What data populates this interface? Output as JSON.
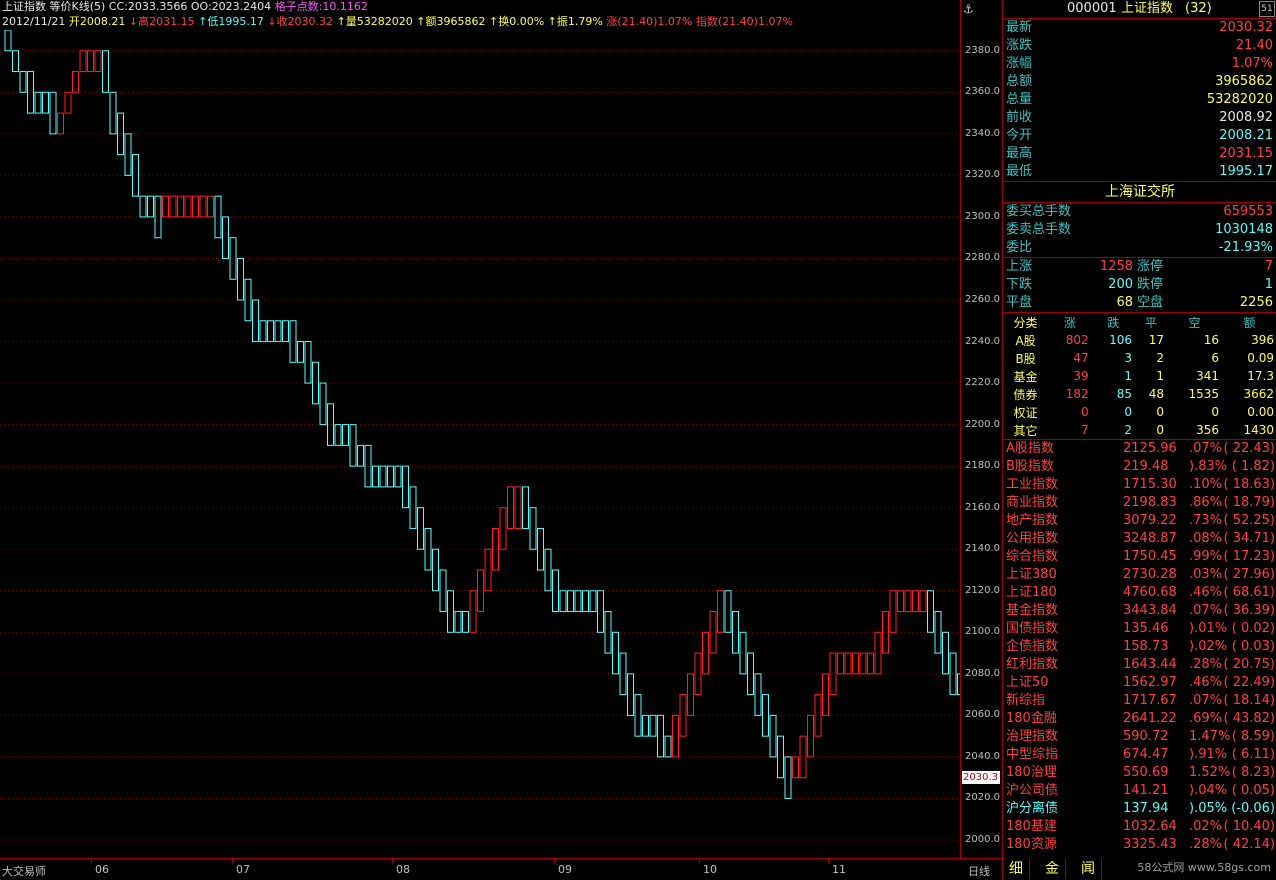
{
  "header": {
    "title": "上证指数",
    "chart_type": "等价K线(5)",
    "cc": "CC:2033.3566",
    "oo": "OO:2023.2404",
    "grid_points": "格子点数:10.1162",
    "date": "2012/11/21",
    "open": "开2008.21",
    "high": "↓高2031.15",
    "low": "↑低1995.17",
    "close": "↓收2030.32",
    "volume": "↑量53282020",
    "amount": "↑额3965862",
    "turnover": "↑换0.00%",
    "amplitude": "↑振1.79%",
    "rise": "涨(21.40)1.07%",
    "index": "指数(21.40)1.07%"
  },
  "chart_data": {
    "type": "point-and-figure",
    "columns": [
      {
        "dir": "down",
        "from": 2390,
        "to": 2380
      },
      {
        "dir": "down",
        "from": 2380,
        "to": 2370
      },
      {
        "dir": "down",
        "from": 2370,
        "to": 2360
      },
      {
        "dir": "down",
        "from": 2370,
        "to": 2350
      },
      {
        "dir": "down",
        "from": 2360,
        "to": 2350
      },
      {
        "dir": "down",
        "from": 2360,
        "to": 2350
      },
      {
        "dir": "down",
        "from": 2360,
        "to": 2340
      },
      {
        "dir": "up",
        "from": 2340,
        "to": 2350
      },
      {
        "dir": "up",
        "from": 2350,
        "to": 2360
      },
      {
        "dir": "up",
        "from": 2360,
        "to": 2370
      },
      {
        "dir": "up",
        "from": 2370,
        "to": 2380
      },
      {
        "dir": "up",
        "from": 2370,
        "to": 2380
      },
      {
        "dir": "up",
        "from": 2370,
        "to": 2380
      },
      {
        "dir": "down",
        "from": 2380,
        "to": 2360
      },
      {
        "dir": "down",
        "from": 2360,
        "to": 2340
      },
      {
        "dir": "down",
        "from": 2350,
        "to": 2330
      },
      {
        "dir": "down",
        "from": 2340,
        "to": 2320
      },
      {
        "dir": "down",
        "from": 2330,
        "to": 2310
      },
      {
        "dir": "down",
        "from": 2310,
        "to": 2300
      },
      {
        "dir": "down",
        "from": 2310,
        "to": 2300
      },
      {
        "dir": "down",
        "from": 2310,
        "to": 2290
      },
      {
        "dir": "up",
        "from": 2300,
        "to": 2310
      },
      {
        "dir": "up",
        "from": 2300,
        "to": 2310
      },
      {
        "dir": "up",
        "from": 2300,
        "to": 2310
      },
      {
        "dir": "up",
        "from": 2300,
        "to": 2310
      },
      {
        "dir": "up",
        "from": 2300,
        "to": 2310
      },
      {
        "dir": "up",
        "from": 2300,
        "to": 2310
      },
      {
        "dir": "up",
        "from": 2300,
        "to": 2310
      },
      {
        "dir": "down",
        "from": 2310,
        "to": 2290
      },
      {
        "dir": "down",
        "from": 2300,
        "to": 2280
      },
      {
        "dir": "down",
        "from": 2290,
        "to": 2270
      },
      {
        "dir": "down",
        "from": 2280,
        "to": 2260
      },
      {
        "dir": "down",
        "from": 2270,
        "to": 2250
      },
      {
        "dir": "down",
        "from": 2260,
        "to": 2240
      },
      {
        "dir": "down",
        "from": 2250,
        "to": 2240
      },
      {
        "dir": "down",
        "from": 2250,
        "to": 2240
      },
      {
        "dir": "down",
        "from": 2250,
        "to": 2240
      },
      {
        "dir": "down",
        "from": 2250,
        "to": 2240
      },
      {
        "dir": "down",
        "from": 2250,
        "to": 2230
      },
      {
        "dir": "down",
        "from": 2240,
        "to": 2230
      },
      {
        "dir": "down",
        "from": 2240,
        "to": 2220
      },
      {
        "dir": "down",
        "from": 2230,
        "to": 2210
      },
      {
        "dir": "down",
        "from": 2220,
        "to": 2200
      },
      {
        "dir": "down",
        "from": 2210,
        "to": 2190
      },
      {
        "dir": "down",
        "from": 2200,
        "to": 2190
      },
      {
        "dir": "down",
        "from": 2200,
        "to": 2190
      },
      {
        "dir": "down",
        "from": 2200,
        "to": 2180
      },
      {
        "dir": "down",
        "from": 2190,
        "to": 2180
      },
      {
        "dir": "down",
        "from": 2190,
        "to": 2170
      },
      {
        "dir": "down",
        "from": 2180,
        "to": 2170
      },
      {
        "dir": "down",
        "from": 2180,
        "to": 2170
      },
      {
        "dir": "down",
        "from": 2180,
        "to": 2170
      },
      {
        "dir": "down",
        "from": 2180,
        "to": 2170
      },
      {
        "dir": "down",
        "from": 2180,
        "to": 2160
      },
      {
        "dir": "down",
        "from": 2170,
        "to": 2150
      },
      {
        "dir": "down",
        "from": 2160,
        "to": 2140
      },
      {
        "dir": "down",
        "from": 2150,
        "to": 2130
      },
      {
        "dir": "down",
        "from": 2140,
        "to": 2120
      },
      {
        "dir": "down",
        "from": 2130,
        "to": 2110
      },
      {
        "dir": "down",
        "from": 2120,
        "to": 2100
      },
      {
        "dir": "down",
        "from": 2110,
        "to": 2100
      },
      {
        "dir": "down",
        "from": 2110,
        "to": 2100
      },
      {
        "dir": "up",
        "from": 2100,
        "to": 2120
      },
      {
        "dir": "up",
        "from": 2110,
        "to": 2130
      },
      {
        "dir": "up",
        "from": 2120,
        "to": 2140
      },
      {
        "dir": "up",
        "from": 2130,
        "to": 2150
      },
      {
        "dir": "up",
        "from": 2140,
        "to": 2160
      },
      {
        "dir": "up",
        "from": 2150,
        "to": 2170
      },
      {
        "dir": "up",
        "from": 2150,
        "to": 2170
      },
      {
        "dir": "down",
        "from": 2170,
        "to": 2150
      },
      {
        "dir": "down",
        "from": 2160,
        "to": 2140
      },
      {
        "dir": "down",
        "from": 2150,
        "to": 2130
      },
      {
        "dir": "down",
        "from": 2140,
        "to": 2120
      },
      {
        "dir": "down",
        "from": 2130,
        "to": 2110
      },
      {
        "dir": "down",
        "from": 2120,
        "to": 2110
      },
      {
        "dir": "down",
        "from": 2120,
        "to": 2110
      },
      {
        "dir": "down",
        "from": 2120,
        "to": 2110
      },
      {
        "dir": "down",
        "from": 2120,
        "to": 2110
      },
      {
        "dir": "down",
        "from": 2120,
        "to": 2110
      },
      {
        "dir": "down",
        "from": 2120,
        "to": 2100
      },
      {
        "dir": "down",
        "from": 2110,
        "to": 2090
      },
      {
        "dir": "down",
        "from": 2100,
        "to": 2080
      },
      {
        "dir": "down",
        "from": 2090,
        "to": 2070
      },
      {
        "dir": "down",
        "from": 2080,
        "to": 2060
      },
      {
        "dir": "down",
        "from": 2070,
        "to": 2050
      },
      {
        "dir": "down",
        "from": 2060,
        "to": 2050
      },
      {
        "dir": "down",
        "from": 2060,
        "to": 2050
      },
      {
        "dir": "down",
        "from": 2060,
        "to": 2040
      },
      {
        "dir": "down",
        "from": 2050,
        "to": 2040
      },
      {
        "dir": "up",
        "from": 2040,
        "to": 2060
      },
      {
        "dir": "up",
        "from": 2050,
        "to": 2070
      },
      {
        "dir": "up",
        "from": 2060,
        "to": 2080
      },
      {
        "dir": "up",
        "from": 2070,
        "to": 2090
      },
      {
        "dir": "up",
        "from": 2080,
        "to": 2100
      },
      {
        "dir": "up",
        "from": 2090,
        "to": 2110
      },
      {
        "dir": "up",
        "from": 2100,
        "to": 2120
      },
      {
        "dir": "down",
        "from": 2120,
        "to": 2100
      },
      {
        "dir": "down",
        "from": 2110,
        "to": 2090
      },
      {
        "dir": "down",
        "from": 2100,
        "to": 2080
      },
      {
        "dir": "down",
        "from": 2090,
        "to": 2070
      },
      {
        "dir": "down",
        "from": 2080,
        "to": 2060
      },
      {
        "dir": "down",
        "from": 2070,
        "to": 2050
      },
      {
        "dir": "down",
        "from": 2060,
        "to": 2040
      },
      {
        "dir": "down",
        "from": 2050,
        "to": 2030
      },
      {
        "dir": "down",
        "from": 2040,
        "to": 2020
      },
      {
        "dir": "up",
        "from": 2030,
        "to": 2040
      },
      {
        "dir": "up",
        "from": 2030,
        "to": 2050
      },
      {
        "dir": "up",
        "from": 2040,
        "to": 2060
      },
      {
        "dir": "up",
        "from": 2050,
        "to": 2070
      },
      {
        "dir": "up",
        "from": 2060,
        "to": 2080
      },
      {
        "dir": "up",
        "from": 2070,
        "to": 2090
      },
      {
        "dir": "up",
        "from": 2080,
        "to": 2090
      },
      {
        "dir": "up",
        "from": 2080,
        "to": 2090
      },
      {
        "dir": "up",
        "from": 2080,
        "to": 2090
      },
      {
        "dir": "up",
        "from": 2080,
        "to": 2090
      },
      {
        "dir": "up",
        "from": 2080,
        "to": 2090
      },
      {
        "dir": "up",
        "from": 2080,
        "to": 2100
      },
      {
        "dir": "up",
        "from": 2090,
        "to": 2110
      },
      {
        "dir": "up",
        "from": 2100,
        "to": 2120
      },
      {
        "dir": "up",
        "from": 2110,
        "to": 2120
      },
      {
        "dir": "up",
        "from": 2110,
        "to": 2120
      },
      {
        "dir": "up",
        "from": 2110,
        "to": 2120
      },
      {
        "dir": "up",
        "from": 2110,
        "to": 2120
      },
      {
        "dir": "down",
        "from": 2120,
        "to": 2100
      },
      {
        "dir": "down",
        "from": 2110,
        "to": 2090
      },
      {
        "dir": "down",
        "from": 2100,
        "to": 2080
      },
      {
        "dir": "down",
        "from": 2090,
        "to": 2070
      },
      {
        "dir": "down",
        "from": 2080,
        "to": 2070
      },
      {
        "dir": "up",
        "from": 2080,
        "to": 2090
      },
      {
        "dir": "up",
        "from": 2090,
        "to": 2100
      },
      {
        "dir": "up",
        "from": 2090,
        "to": 2100
      },
      {
        "dir": "up",
        "from": 2090,
        "to": 2100
      },
      {
        "dir": "up",
        "from": 2090,
        "to": 2100
      },
      {
        "dir": "up",
        "from": 2090,
        "to": 2100
      },
      {
        "dir": "down",
        "from": 2100,
        "to": 2090
      },
      {
        "dir": "down",
        "from": 2090,
        "to": 2080
      },
      {
        "dir": "down",
        "from": 2090,
        "to": 2070
      },
      {
        "dir": "down",
        "from": 2080,
        "to": 2070
      },
      {
        "dir": "down",
        "from": 2080,
        "to": 2060
      },
      {
        "dir": "down",
        "from": 2070,
        "to": 2060
      },
      {
        "dir": "down",
        "from": 2070,
        "to": 2050
      },
      {
        "dir": "down",
        "from": 2060,
        "to": 2040
      },
      {
        "dir": "down",
        "from": 2050,
        "to": 2030
      },
      {
        "dir": "down",
        "from": 2040,
        "to": 2020
      },
      {
        "dir": "down",
        "from": 2030,
        "to": 2020
      }
    ],
    "ylim": [
      2000,
      2390
    ],
    "yticks": [
      "2380.0",
      "2360.0",
      "2340.0",
      "2320.0",
      "2300.0",
      "2280.0",
      "2260.0",
      "2240.0",
      "2220.0",
      "2200.0",
      "2180.0",
      "2160.0",
      "2140.0",
      "2120.0",
      "2100.0",
      "2080.0",
      "2060.0",
      "2040.0",
      "2020.0",
      "2000.0"
    ],
    "xticks": [
      "06",
      "07",
      "08",
      "09",
      "10",
      "11"
    ],
    "last_price": "2030.3",
    "colors": {
      "up": "#ff2020",
      "down": "#55ffff",
      "grid": "#800000"
    }
  },
  "bottom": {
    "app_name": "大交易师",
    "period": "日线"
  },
  "panel": {
    "code": "000001",
    "name": "上证指数",
    "name_suffix": "(32)",
    "quote": [
      {
        "k": "最新",
        "v": "2030.32",
        "c": "#ff4040"
      },
      {
        "k": "涨跌",
        "v": "21.40",
        "c": "#ff4040"
      },
      {
        "k": "涨幅",
        "v": "1.07%",
        "c": "#ff4040"
      },
      {
        "k": "总额",
        "v": "3965862",
        "c": "#ffff55"
      },
      {
        "k": "总量",
        "v": "53282020",
        "c": "#ffff55"
      },
      {
        "k": "前收",
        "v": "2008.92",
        "c": "#e8e8e8"
      },
      {
        "k": "今开",
        "v": "2008.21",
        "c": "#55ffff"
      },
      {
        "k": "最高",
        "v": "2031.15",
        "c": "#ff4040"
      },
      {
        "k": "最低",
        "v": "1995.17",
        "c": "#55ffff"
      }
    ],
    "exchange": "上海证交所",
    "orders": [
      {
        "k": "委买总手数",
        "v": "659553",
        "c": "#ff4040"
      },
      {
        "k": "委卖总手数",
        "v": "1030148",
        "c": "#55ffff"
      },
      {
        "k": "委比",
        "v": "-21.93%",
        "c": "#55ffff"
      }
    ],
    "advdec": [
      {
        "k1": "上涨",
        "v1": "1258",
        "c1": "#ff4040",
        "k2": "涨停",
        "v2": "7",
        "c2": "#ff4040"
      },
      {
        "k1": "下跌",
        "v1": "200",
        "c1": "#55ffff",
        "k2": "跌停",
        "v2": "1",
        "c2": "#55ffff"
      },
      {
        "k1": "平盘",
        "v1": "68",
        "c1": "#ffff55",
        "k2": "空盘",
        "v2": "2256",
        "c2": "#ffff55"
      }
    ],
    "cat_headers": [
      "分类",
      "涨",
      "跌",
      "平",
      "空",
      "额"
    ],
    "categories": [
      [
        "A股",
        "802",
        "106",
        "17",
        "16",
        "396"
      ],
      [
        "B股",
        "47",
        "3",
        "2",
        "6",
        "0.09"
      ],
      [
        "基金",
        "39",
        "1",
        "1",
        "341",
        "17.3"
      ],
      [
        "债券",
        "182",
        "85",
        "48",
        "1535",
        "3662"
      ],
      [
        "权证",
        "0",
        "0",
        "0",
        "0",
        "0.00"
      ],
      [
        "其它",
        "7",
        "2",
        "0",
        "356",
        "1430"
      ]
    ],
    "indices": [
      {
        "n": "A股指数",
        "p": "2125.96",
        "pc": ".07%",
        "ch": "( 22.43)",
        "c": "#ff4040"
      },
      {
        "n": "B股指数",
        "p": "219.48",
        "pc": ").83%",
        "ch": "( 1.82)",
        "c": "#ff4040"
      },
      {
        "n": "工业指数",
        "p": "1715.30",
        "pc": ".10%",
        "ch": "( 18.63)",
        "c": "#ff4040"
      },
      {
        "n": "商业指数",
        "p": "2198.83",
        "pc": ".86%",
        "ch": "( 18.79)",
        "c": "#ff4040"
      },
      {
        "n": "地产指数",
        "p": "3079.22",
        "pc": ".73%",
        "ch": "( 52.25)",
        "c": "#ff4040"
      },
      {
        "n": "公用指数",
        "p": "3248.87",
        "pc": ".08%",
        "ch": "( 34.71)",
        "c": "#ff4040"
      },
      {
        "n": "综合指数",
        "p": "1750.45",
        "pc": ".99%",
        "ch": "( 17.23)",
        "c": "#ff4040"
      },
      {
        "n": "上证380",
        "p": "2730.28",
        "pc": ".03%",
        "ch": "( 27.96)",
        "c": "#ff4040"
      },
      {
        "n": "上证180",
        "p": "4760.68",
        "pc": ".46%",
        "ch": "( 68.61)",
        "c": "#ff4040"
      },
      {
        "n": "基金指数",
        "p": "3443.84",
        "pc": ".07%",
        "ch": "( 36.39)",
        "c": "#ff4040"
      },
      {
        "n": "国债指数",
        "p": "135.46",
        "pc": ").01%",
        "ch": "( 0.02)",
        "c": "#ff4040"
      },
      {
        "n": "企债指数",
        "p": "158.73",
        "pc": ").02%",
        "ch": "( 0.03)",
        "c": "#ff4040"
      },
      {
        "n": "红利指数",
        "p": "1643.44",
        "pc": ".28%",
        "ch": "( 20.75)",
        "c": "#ff4040"
      },
      {
        "n": "上证50",
        "p": "1562.97",
        "pc": ".46%",
        "ch": "( 22.49)",
        "c": "#ff4040"
      },
      {
        "n": "新综指",
        "p": "1717.67",
        "pc": ".07%",
        "ch": "( 18.14)",
        "c": "#ff4040"
      },
      {
        "n": "180金融",
        "p": "2641.22",
        "pc": ".69%",
        "ch": "( 43.82)",
        "c": "#ff4040"
      },
      {
        "n": "治理指数",
        "p": "590.72",
        "pc": "1.47%",
        "ch": "( 8.59)",
        "c": "#ff4040"
      },
      {
        "n": "中型综指",
        "p": "674.47",
        "pc": ").91%",
        "ch": "( 6.11)",
        "c": "#ff4040"
      },
      {
        "n": "180治理",
        "p": "550.69",
        "pc": "1.52%",
        "ch": "( 8.23)",
        "c": "#ff4040"
      },
      {
        "n": "沪公司债",
        "p": "141.21",
        "pc": ").04%",
        "ch": "( 0.05)",
        "c": "#ff4040"
      },
      {
        "n": "沪分离债",
        "p": "137.94",
        "pc": ").05%",
        "ch": "(-0.06)",
        "c": "#55ffff"
      },
      {
        "n": "180基建",
        "p": "1032.64",
        "pc": ".02%",
        "ch": "( 10.40)",
        "c": "#ff4040"
      },
      {
        "n": "180资源",
        "p": "3325.43",
        "pc": ".28%",
        "ch": "( 42.14)",
        "c": "#ff4040"
      }
    ],
    "tabs": [
      "细",
      "金",
      "闻"
    ],
    "watermark": "58公式网 www.58gs.com"
  }
}
